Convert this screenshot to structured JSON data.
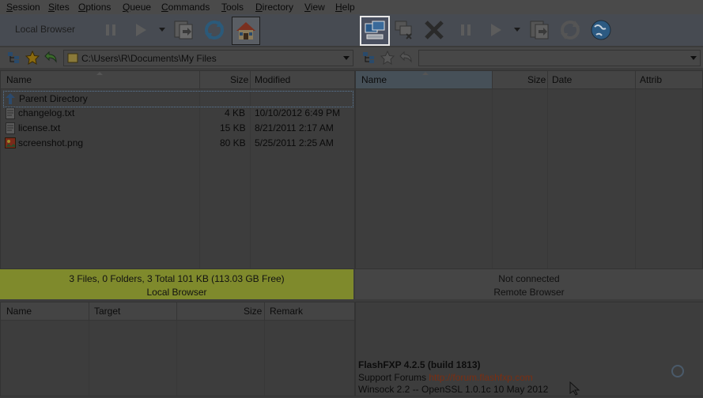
{
  "menu": [
    {
      "u": "S",
      "rest": "ession"
    },
    {
      "u": "S",
      "rest": "ites"
    },
    {
      "u": "O",
      "rest": "ptions"
    },
    {
      "u": "Q",
      "rest": "ueue"
    },
    {
      "u": "C",
      "rest": "ommands"
    },
    {
      "u": "T",
      "rest": "ools"
    },
    {
      "u": "D",
      "rest": "irectory"
    },
    {
      "u": "V",
      "rest": "iew"
    },
    {
      "u": "H",
      "rest": "elp"
    }
  ],
  "toolbar": {
    "local_browser_label": "Local Browser"
  },
  "local": {
    "path": "C:\\Users\\R\\Documents\\My Files",
    "columns": {
      "name": "Name",
      "size": "Size",
      "modified": "Modified"
    },
    "rows": [
      {
        "name": "Parent Directory",
        "size": "",
        "modified": "",
        "icon": "parent-dir-icon"
      },
      {
        "name": "changelog.txt",
        "size": "4 KB",
        "modified": "10/10/2012 6:49 PM",
        "icon": "text-file-icon"
      },
      {
        "name": "license.txt",
        "size": "15 KB",
        "modified": "8/21/2011 2:17 AM",
        "icon": "text-file-icon"
      },
      {
        "name": "screenshot.png",
        "size": "80 KB",
        "modified": "5/25/2011 2:25 AM",
        "icon": "image-file-icon"
      }
    ],
    "status_summary": "3 Files, 0 Folders, 3 Total 101 KB (113.03 GB Free)",
    "status_title": "Local Browser"
  },
  "remote": {
    "path": "",
    "columns": {
      "name": "Name",
      "size": "Size",
      "date": "Date",
      "attrib": "Attrib"
    },
    "status_summary": "Not connected",
    "status_title": "Remote Browser"
  },
  "queue": {
    "columns": {
      "name": "Name",
      "target": "Target",
      "size": "Size",
      "remark": "Remark"
    }
  },
  "log": {
    "line1": "FlashFXP 4.2.5 (build 1813)",
    "line2_prefix": "Support Forums ",
    "line2_link": "http://forum.flashfxp.com",
    "line3": "Winsock 2.2 -- OpenSSL 1.0.1c 10 May 2012"
  },
  "colors": {
    "local_status_bg": "#7f8a2c",
    "link": "#7a2e12"
  }
}
